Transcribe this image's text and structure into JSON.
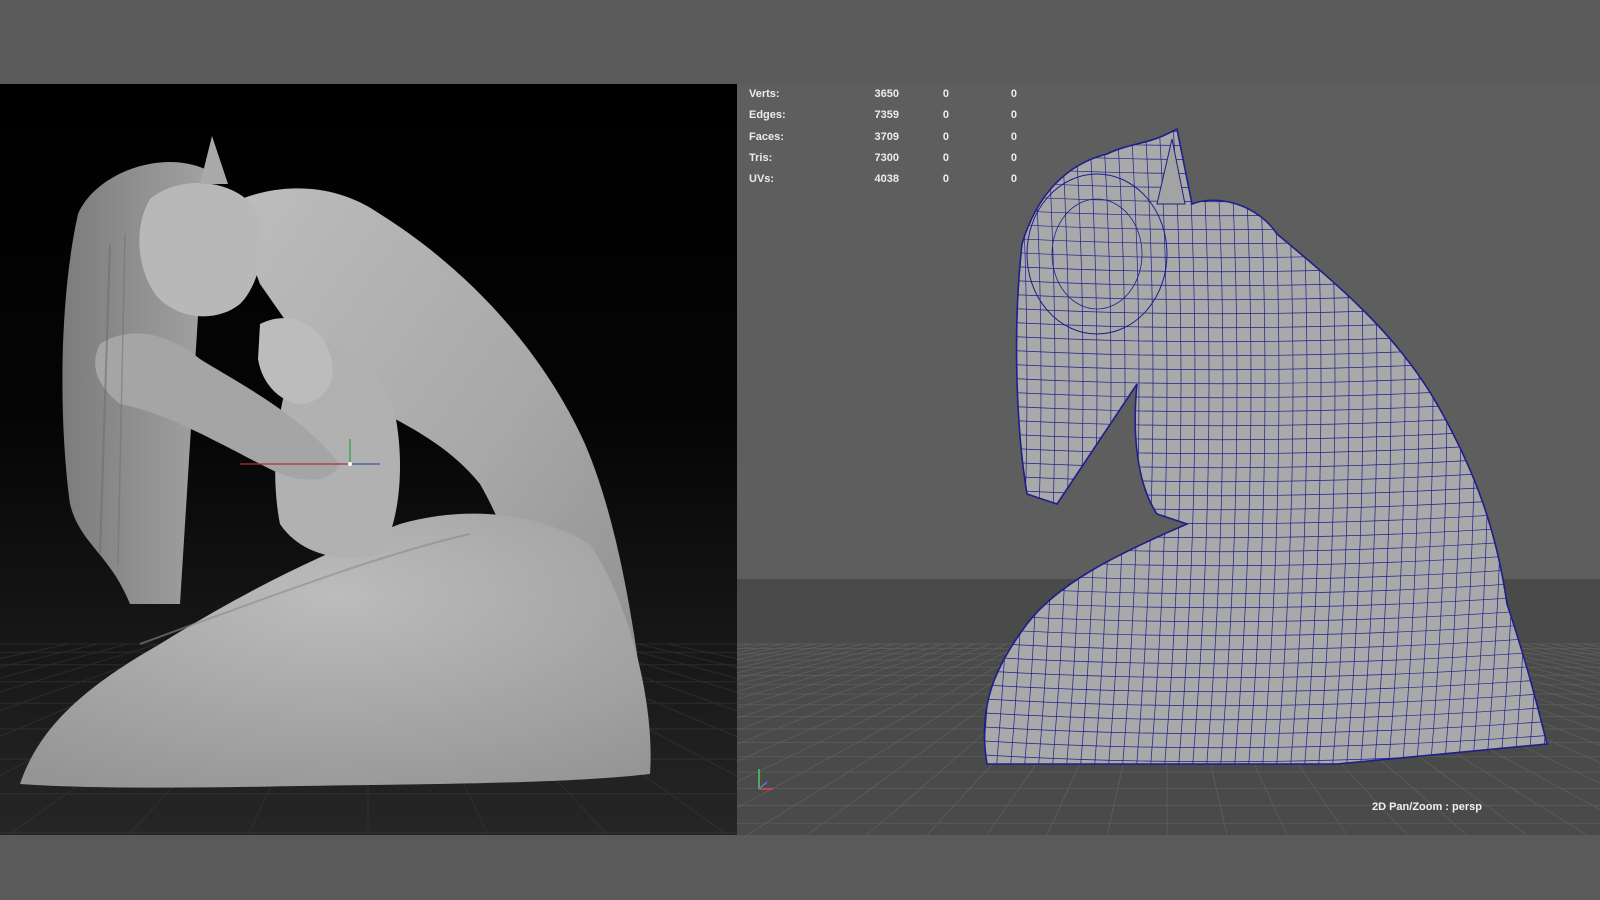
{
  "colors": {
    "wire": "#1e1e8c",
    "clay_grey": "#b4b4b4",
    "maya_bg": "#5e5e5e",
    "zbrush_bg": "#000000"
  },
  "hud": {
    "rows": [
      {
        "label": "Verts:",
        "total": "3650",
        "selected": "0",
        "visible": "0"
      },
      {
        "label": "Edges:",
        "total": "7359",
        "selected": "0",
        "visible": "0"
      },
      {
        "label": "Faces:",
        "total": "3709",
        "selected": "0",
        "visible": "0"
      },
      {
        "label": "Tris:",
        "total": "7300",
        "selected": "0",
        "visible": "0"
      },
      {
        "label": "UVs:",
        "total": "4038",
        "selected": "0",
        "visible": "0"
      }
    ]
  },
  "camera_label": "2D Pan/Zoom : persp",
  "icons": {
    "left_gizmo": "transform-gizmo-icon",
    "right_gizmo": "axis-gizmo-icon"
  }
}
